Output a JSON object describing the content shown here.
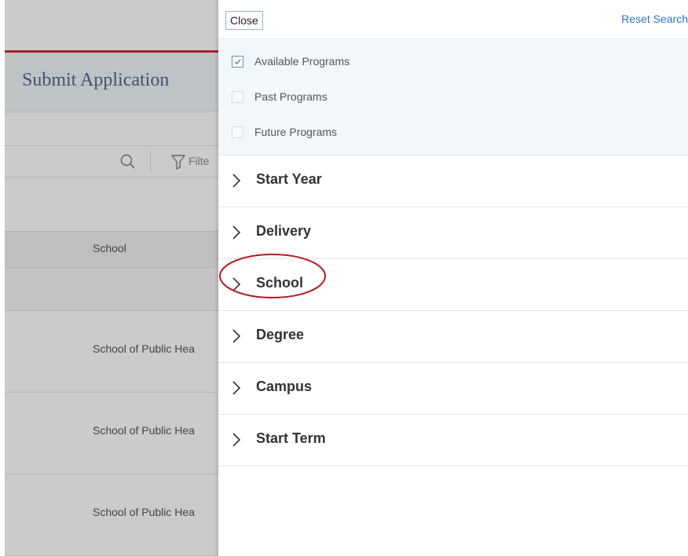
{
  "background": {
    "page_title": "Submit Application",
    "filter_label": "Filte",
    "column_header": "School",
    "rows": [
      {
        "school": "School of Public Hea"
      },
      {
        "school": "School of Public Hea"
      },
      {
        "school": "School of Public Hea"
      }
    ]
  },
  "panel": {
    "close_label": "Close",
    "reset_label": "Reset Search",
    "program_options": [
      {
        "label": "Available Programs",
        "checked": true
      },
      {
        "label": "Past Programs",
        "checked": false
      },
      {
        "label": "Future Programs",
        "checked": false
      }
    ],
    "sections": [
      {
        "label": "Start Year"
      },
      {
        "label": "Delivery"
      },
      {
        "label": "School"
      },
      {
        "label": "Degree"
      },
      {
        "label": "Campus"
      },
      {
        "label": "Start Term"
      }
    ]
  },
  "colors": {
    "accent_link": "#2f74c0",
    "title_text": "#3f5472",
    "header_rule": "#a8242a",
    "annotation_ellipse": "#b01c22"
  }
}
